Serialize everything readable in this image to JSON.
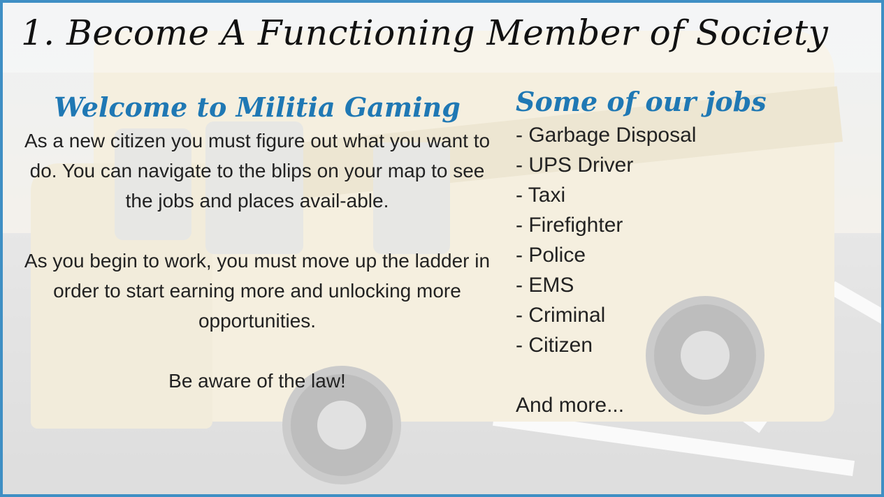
{
  "title": "1. Become A Functioning Member of Society",
  "welcome": {
    "heading": "Welcome to Militia Gaming",
    "paragraph1": "As a new citizen you must figure out what you want to do. You can navigate to the blips on your map to see the jobs and places avail-able.",
    "paragraph2": "As you begin to work, you must move up the ladder in order to start earning more and unlocking more opportunities.",
    "paragraph3": "Be aware of the law!"
  },
  "jobs": {
    "heading": "Some of our jobs",
    "items": [
      "- Garbage Disposal",
      "- UPS Driver",
      "- Taxi",
      "- Firefighter",
      "- Police",
      "- EMS",
      "- Criminal",
      "- Citizen"
    ],
    "more": "And more..."
  },
  "colors": {
    "border": "#3f8fc4",
    "heading": "#1f78b4",
    "text": "#222222"
  }
}
